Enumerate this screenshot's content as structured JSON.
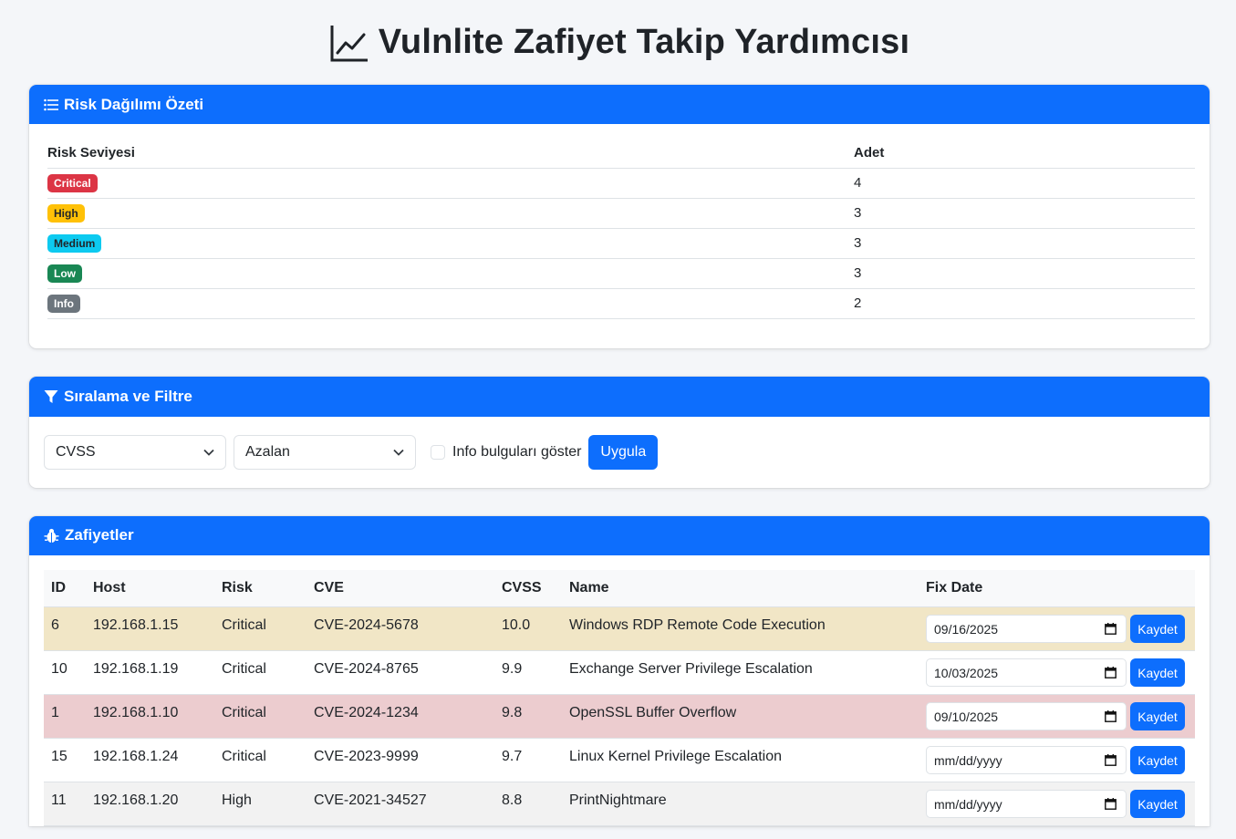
{
  "title": "Vulnlite Zafiyet Takip Yardımcısı",
  "summary": {
    "header": "Risk Dağılımı Özeti",
    "columns": [
      "Risk Seviyesi",
      "Adet"
    ],
    "rows": [
      {
        "level": "Critical",
        "count": "4",
        "bg": "#dc3545",
        "fg": "#ffffff"
      },
      {
        "level": "High",
        "count": "3",
        "bg": "#ffc107",
        "fg": "#212529"
      },
      {
        "level": "Medium",
        "count": "3",
        "bg": "#0dcaf0",
        "fg": "#212529"
      },
      {
        "level": "Low",
        "count": "3",
        "bg": "#198754",
        "fg": "#ffffff"
      },
      {
        "level": "Info",
        "count": "2",
        "bg": "#6c757d",
        "fg": "#ffffff"
      }
    ]
  },
  "filter": {
    "header": "Sıralama ve Filtre",
    "sort_field": "CVSS",
    "sort_order": "Azalan",
    "show_info_label": "Info bulguları göster",
    "show_info_checked": false,
    "apply_label": "Uygula"
  },
  "vulns": {
    "header": "Zafiyetler",
    "columns": [
      "ID",
      "Host",
      "Risk",
      "CVE",
      "CVSS",
      "Name",
      "Fix Date"
    ],
    "save_label": "Kaydet",
    "rows": [
      {
        "id": "6",
        "host": "192.168.1.15",
        "risk": "Critical",
        "cve": "CVE-2024-5678",
        "cvss": "10.0",
        "name": "Windows RDP Remote Code Execution",
        "fix_date": "09/16/2025",
        "row_color": "#f1e6c6"
      },
      {
        "id": "10",
        "host": "192.168.1.19",
        "risk": "Critical",
        "cve": "CVE-2024-8765",
        "cvss": "9.9",
        "name": "Exchange Server Privilege Escalation",
        "fix_date": "10/03/2025",
        "row_color": "#ffffff"
      },
      {
        "id": "1",
        "host": "192.168.1.10",
        "risk": "Critical",
        "cve": "CVE-2024-1234",
        "cvss": "9.8",
        "name": "OpenSSL Buffer Overflow",
        "fix_date": "09/10/2025",
        "row_color": "#eccccf"
      },
      {
        "id": "15",
        "host": "192.168.1.24",
        "risk": "Critical",
        "cve": "CVE-2023-9999",
        "cvss": "9.7",
        "name": "Linux Kernel Privilege Escalation",
        "fix_date": "mm/dd/yyyy",
        "row_color": "#ffffff"
      },
      {
        "id": "11",
        "host": "192.168.1.20",
        "risk": "High",
        "cve": "CVE-2021-34527",
        "cvss": "8.8",
        "name": "PrintNightmare",
        "fix_date": "mm/dd/yyyy",
        "row_color": "#f2f2f2"
      }
    ]
  }
}
